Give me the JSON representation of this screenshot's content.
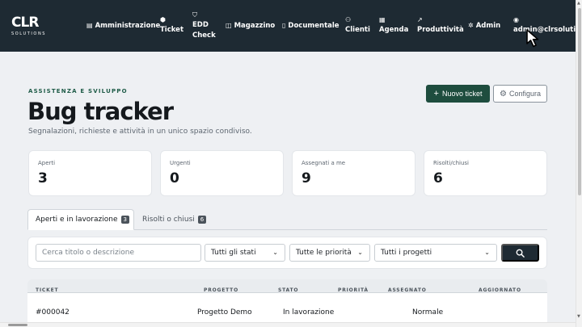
{
  "logo": {
    "mark_left": "CL",
    "mark_right": "R",
    "sub": "SOLUTIONS"
  },
  "nav": {
    "items": [
      {
        "icon": "▤",
        "label": "Amministrazione"
      },
      {
        "icon": "⬢",
        "label": "Ticket"
      },
      {
        "icon": "⛉",
        "label_line1": "EDD",
        "label_line2": "Check"
      },
      {
        "icon": "◫",
        "label": "Magazzino"
      },
      {
        "icon": "▯",
        "label": "Documentale"
      },
      {
        "icon": "⚇",
        "label": "Clienti"
      },
      {
        "icon": "▦",
        "label": "Agenda"
      },
      {
        "icon": "↗",
        "label": "Produttività"
      },
      {
        "icon": "✲",
        "label": "Admin"
      },
      {
        "icon": "◉",
        "label": "admin@clrsolutions."
      }
    ]
  },
  "header": {
    "eyebrow": "ASSISTENZA E SVILUPPO",
    "title": "Bug tracker",
    "subtitle": "Segnalazioni, richieste e attività in un unico spazio condiviso.",
    "new_ticket": "Nuovo ticket",
    "new_ticket_icon": "+",
    "configure": "Configura",
    "configure_icon": "⚙"
  },
  "stats": [
    {
      "label": "Aperti",
      "value": "3"
    },
    {
      "label": "Urgenti",
      "value": "0"
    },
    {
      "label": "Assegnati a me",
      "value": "9"
    },
    {
      "label": "Risolti/chiusi",
      "value": "6"
    }
  ],
  "tabs": [
    {
      "label": "Aperti e in lavorazione",
      "count": "3"
    },
    {
      "label": "Risolti o chiusi",
      "count": "6"
    }
  ],
  "filters": {
    "search_placeholder": "Cerca titolo o descrizione",
    "status": "Tutti gli stati",
    "priority": "Tutte le priorità",
    "project": "Tutti i progetti"
  },
  "table": {
    "columns": [
      "TICKET",
      "PROGETTO",
      "STATO",
      "PRIORITÀ",
      "ASSEGNATO",
      "AGGIORNATO"
    ],
    "rows": [
      {
        "ticket": "#000042",
        "project": "Progetto Demo",
        "status": "In lavorazione",
        "priority": "Normale"
      }
    ]
  },
  "colors": {
    "nav_bg": "#1e2a33",
    "accent": "#1e4d3e",
    "page_bg": "#eef0f3"
  }
}
